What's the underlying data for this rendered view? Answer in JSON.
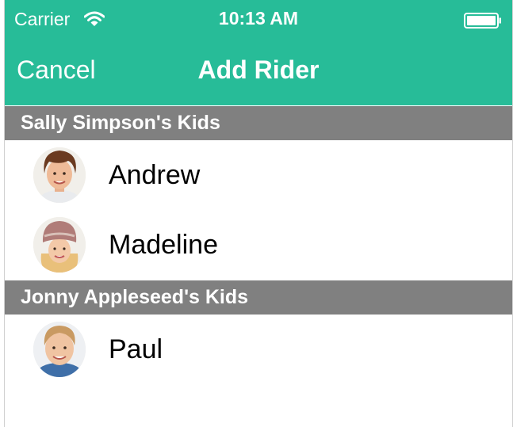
{
  "status_bar": {
    "carrier": "Carrier",
    "time": "10:13 AM",
    "wifi_icon": "wifi-icon",
    "battery_icon": "battery-icon"
  },
  "nav": {
    "cancel_label": "Cancel",
    "title": "Add Rider"
  },
  "colors": {
    "accent": "#27bc98",
    "section_header_bg": "#808080"
  },
  "sections": [
    {
      "header": "Sally Simpson's Kids",
      "riders": [
        {
          "name": "Andrew"
        },
        {
          "name": "Madeline"
        }
      ]
    },
    {
      "header": "Jonny Appleseed's Kids",
      "riders": [
        {
          "name": "Paul"
        }
      ]
    }
  ]
}
